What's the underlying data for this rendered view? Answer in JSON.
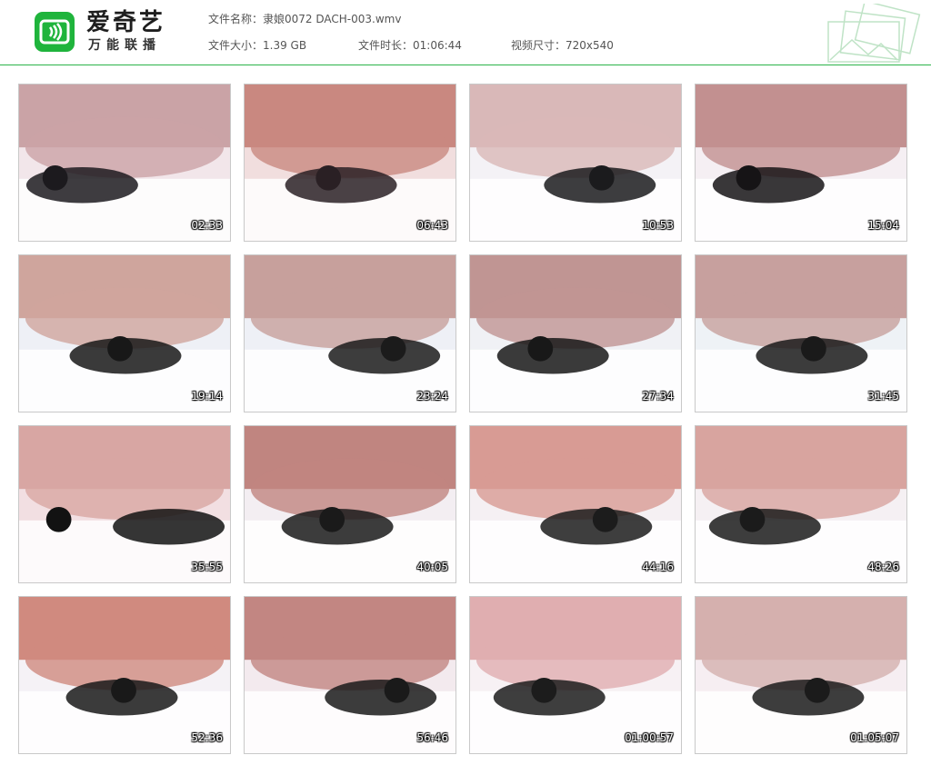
{
  "app": {
    "logo_title": "爱奇艺",
    "logo_subtitle": "万能联播",
    "logo_icon": "iqiyi-tv-icon",
    "brand_color": "#1fb43c"
  },
  "file_info": {
    "name_label": "文件名称：",
    "name_value": "隶娘0072 DACH-003.wmv",
    "size_label": "文件大小：",
    "size_value": "1.39 GB",
    "duration_label": "文件时长：",
    "duration_value": "01:06:44",
    "resolution_label": "视频尺寸：",
    "resolution_value": "720x540"
  },
  "thumbnails": [
    {
      "timestamp": "02:33"
    },
    {
      "timestamp": "06:43"
    },
    {
      "timestamp": "10:53"
    },
    {
      "timestamp": "15:04"
    },
    {
      "timestamp": "19:14"
    },
    {
      "timestamp": "23:24"
    },
    {
      "timestamp": "27:34"
    },
    {
      "timestamp": "31:45"
    },
    {
      "timestamp": "35:55"
    },
    {
      "timestamp": "40:05"
    },
    {
      "timestamp": "44:16"
    },
    {
      "timestamp": "48:26"
    },
    {
      "timestamp": "52:36"
    },
    {
      "timestamp": "56:46"
    },
    {
      "timestamp": "01:00:57"
    },
    {
      "timestamp": "01:05:07"
    }
  ]
}
